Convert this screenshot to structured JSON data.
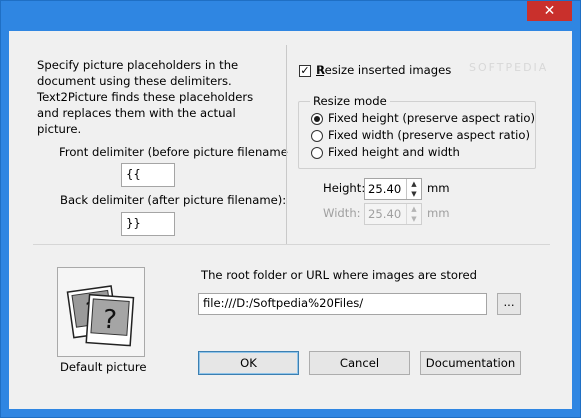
{
  "window": {
    "close_glyph": "✕",
    "watermark": "SOFTPEDIA"
  },
  "delimiters": {
    "intro_text": "Specify picture placeholders in the document using these delimiters. Text2Picture finds these placeholders and replaces them with the actual picture.",
    "front_label": "Front delimiter (before picture filename",
    "front_value": "{{",
    "back_label": "Back delimiter (after picture filename):",
    "back_value": "}}"
  },
  "resize": {
    "checkbox_label": "Resize inserted images",
    "checked": true,
    "mode_title": "Resize mode",
    "options": [
      {
        "label": "Fixed height (preserve aspect ratio)",
        "selected": true
      },
      {
        "label": "Fixed width (preserve aspect ratio)",
        "selected": false
      },
      {
        "label": "Fixed height and width",
        "selected": false
      }
    ],
    "height_label": "Height:",
    "height_value": "25.40",
    "height_unit": "mm",
    "width_label": "Width:",
    "width_value": "25.40",
    "width_unit": "mm"
  },
  "default_picture": {
    "label": "Default picture"
  },
  "root_folder": {
    "label": "The root folder or URL where images are stored",
    "value": "file:///D:/Softpedia%20Files/",
    "browse_label": "..."
  },
  "buttons": {
    "ok": "OK",
    "cancel": "Cancel",
    "documentation": "Documentation"
  }
}
